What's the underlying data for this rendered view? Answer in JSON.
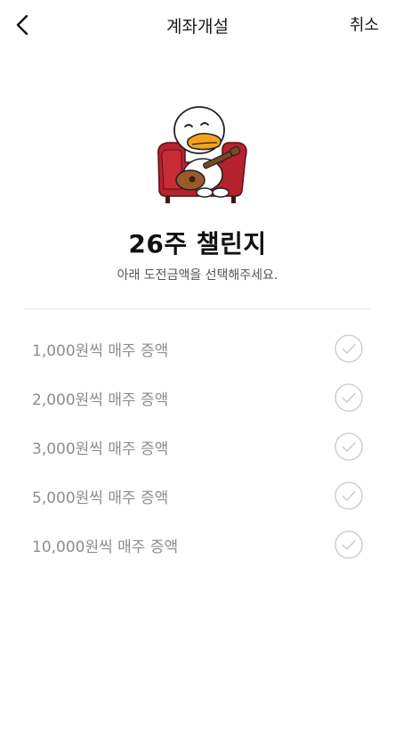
{
  "header": {
    "title": "계좌개설",
    "back_icon": "chevron-left-icon",
    "cancel_label": "취소"
  },
  "challenge": {
    "title": "26주 챌린지",
    "subtitle": "아래 도전금액을 선택해주세요."
  },
  "options": [
    {
      "label": "1,000원씩 매주 증액",
      "icon": "check-circle-icon"
    },
    {
      "label": "2,000원씩 매주 증액",
      "icon": "check-circle-icon"
    },
    {
      "label": "3,000원씩 매주 증액",
      "icon": "check-circle-icon"
    },
    {
      "label": "5,000원씩 매주 증액",
      "icon": "check-circle-icon"
    },
    {
      "label": "10,000원씩 매주 증액",
      "icon": "check-circle-icon"
    }
  ],
  "colors": {
    "accent_text": "#111111",
    "option_text": "#8d8d8d",
    "check_stroke": "#c9c9c9",
    "sofa": "#b5232f",
    "duck_beak": "#f4a21b",
    "ukulele": "#9a5a2b"
  }
}
